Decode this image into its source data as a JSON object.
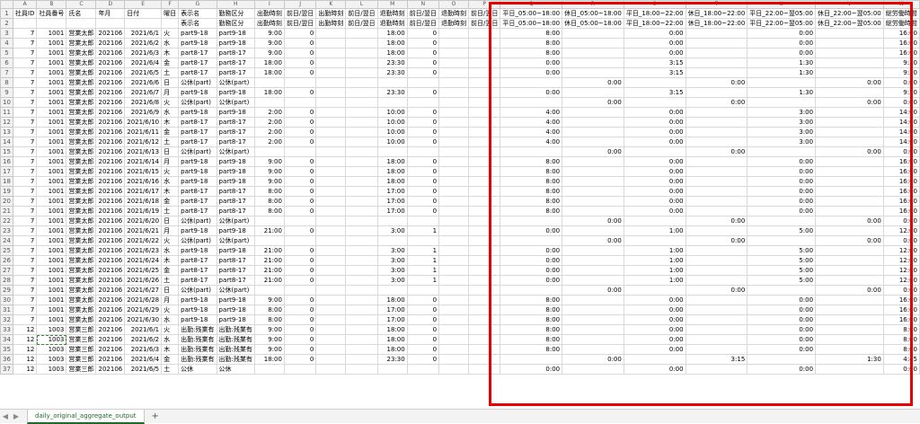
{
  "columns": [
    "A",
    "B",
    "C",
    "D",
    "E",
    "F",
    "G",
    "H",
    "I",
    "J",
    "K",
    "L",
    "M",
    "N",
    "O",
    "P",
    "Q",
    "R",
    "S",
    "T",
    "U",
    "V",
    "W"
  ],
  "header1": [
    "社員ID",
    "社員番号",
    "氏名",
    "年月",
    "日付",
    "曜日",
    "表示名",
    "勤務区分",
    "出勤時刻",
    "前日/翌日",
    "出勤時刻",
    "前日/翌日",
    "退勤時刻",
    "前日/翌日",
    "退勤時刻",
    "前日/翌日",
    "平日_05:00~18:00",
    "休日_05:00~18:00",
    "平日_18:00~22:00",
    "休日_18:00~22:00",
    "平日_22:00~翌05:00",
    "休日_22:00~翌05:00",
    "総労働時間"
  ],
  "header2": [
    "",
    "",
    "",
    "",
    "",
    "",
    "表示名",
    "勤務区分",
    "出勤時刻",
    "前日/翌日",
    "出勤時刻",
    "前日/翌日",
    "退勤時刻",
    "前日/翌日",
    "退勤時刻",
    "前日/翌日",
    "平日_05:00~18:00",
    "休日_05:00~18:00",
    "平日_18:00~22:00",
    "休日_18:00~22:00",
    "平日_22:00~翌05:00",
    "休日_22:00~翌05:00",
    "総労働時間"
  ],
  "rows": [
    [
      "7",
      "1001",
      "営業太郎",
      "202106",
      "2021/6/1",
      "火",
      "part9-18",
      "part9-18",
      "9:00",
      "0",
      "",
      "",
      "18:00",
      "0",
      "",
      "",
      "8:00",
      "",
      "0:00",
      "",
      "0:00",
      "",
      "16:00"
    ],
    [
      "7",
      "1001",
      "営業太郎",
      "202106",
      "2021/6/2",
      "水",
      "part9-18",
      "part9-18",
      "9:00",
      "0",
      "",
      "",
      "18:00",
      "0",
      "",
      "",
      "8:00",
      "",
      "0:00",
      "",
      "0:00",
      "",
      "16:00"
    ],
    [
      "7",
      "1001",
      "営業太郎",
      "202106",
      "2021/6/3",
      "木",
      "part8-17",
      "part8-17",
      "9:00",
      "0",
      "",
      "",
      "18:00",
      "0",
      "",
      "",
      "8:00",
      "",
      "0:00",
      "",
      "0:00",
      "",
      "16:00"
    ],
    [
      "7",
      "1001",
      "営業太郎",
      "202106",
      "2021/6/4",
      "金",
      "part8-17",
      "part8-17",
      "18:00",
      "0",
      "",
      "",
      "23:30",
      "0",
      "",
      "",
      "0:00",
      "",
      "3:15",
      "",
      "1:30",
      "",
      "9:30"
    ],
    [
      "7",
      "1001",
      "営業太郎",
      "202106",
      "2021/6/5",
      "土",
      "part8-17",
      "part8-17",
      "18:00",
      "0",
      "",
      "",
      "23:30",
      "0",
      "",
      "",
      "0:00",
      "",
      "3:15",
      "",
      "1:30",
      "",
      "9:30"
    ],
    [
      "7",
      "1001",
      "営業太郎",
      "202106",
      "2021/6/6",
      "日",
      "公休(part)",
      "公休(part)",
      "",
      "",
      "",
      "",
      "",
      "",
      "",
      "",
      "",
      "0:00",
      "",
      "0:00",
      "",
      "0:00",
      "0:00"
    ],
    [
      "7",
      "1001",
      "営業太郎",
      "202106",
      "2021/6/7",
      "月",
      "part9-18",
      "part9-18",
      "18:00",
      "0",
      "",
      "",
      "23:30",
      "0",
      "",
      "",
      "0:00",
      "",
      "3:15",
      "",
      "1:30",
      "",
      "9:30"
    ],
    [
      "7",
      "1001",
      "営業太郎",
      "202106",
      "2021/6/8",
      "火",
      "公休(part)",
      "公休(part)",
      "",
      "",
      "",
      "",
      "",
      "",
      "",
      "",
      "",
      "0:00",
      "",
      "0:00",
      "",
      "0:00",
      "0:00"
    ],
    [
      "7",
      "1001",
      "営業太郎",
      "202106",
      "2021/6/9",
      "水",
      "part9-18",
      "part9-18",
      "2:00",
      "0",
      "",
      "",
      "10:00",
      "0",
      "",
      "",
      "4:00",
      "",
      "0:00",
      "",
      "3:00",
      "",
      "14:00"
    ],
    [
      "7",
      "1001",
      "営業太郎",
      "202106",
      "2021/6/10",
      "木",
      "part8-17",
      "part8-17",
      "2:00",
      "0",
      "",
      "",
      "10:00",
      "0",
      "",
      "",
      "4:00",
      "",
      "0:00",
      "",
      "3:00",
      "",
      "14:00"
    ],
    [
      "7",
      "1001",
      "営業太郎",
      "202106",
      "2021/6/11",
      "金",
      "part8-17",
      "part8-17",
      "2:00",
      "0",
      "",
      "",
      "10:00",
      "0",
      "",
      "",
      "4:00",
      "",
      "0:00",
      "",
      "3:00",
      "",
      "14:00"
    ],
    [
      "7",
      "1001",
      "営業太郎",
      "202106",
      "2021/6/12",
      "土",
      "part8-17",
      "part8-17",
      "2:00",
      "0",
      "",
      "",
      "10:00",
      "0",
      "",
      "",
      "4:00",
      "",
      "0:00",
      "",
      "3:00",
      "",
      "14:00"
    ],
    [
      "7",
      "1001",
      "営業太郎",
      "202106",
      "2021/6/13",
      "日",
      "公休(part)",
      "公休(part)",
      "",
      "",
      "",
      "",
      "",
      "",
      "",
      "",
      "",
      "0:00",
      "",
      "0:00",
      "",
      "0:00",
      "0:00"
    ],
    [
      "7",
      "1001",
      "営業太郎",
      "202106",
      "2021/6/14",
      "月",
      "part9-18",
      "part9-18",
      "9:00",
      "0",
      "",
      "",
      "18:00",
      "0",
      "",
      "",
      "8:00",
      "",
      "0:00",
      "",
      "0:00",
      "",
      "16:00"
    ],
    [
      "7",
      "1001",
      "営業太郎",
      "202106",
      "2021/6/15",
      "火",
      "part9-18",
      "part9-18",
      "9:00",
      "0",
      "",
      "",
      "18:00",
      "0",
      "",
      "",
      "8:00",
      "",
      "0:00",
      "",
      "0:00",
      "",
      "16:00"
    ],
    [
      "7",
      "1001",
      "営業太郎",
      "202106",
      "2021/6/16",
      "水",
      "part9-18",
      "part9-18",
      "9:00",
      "0",
      "",
      "",
      "18:00",
      "0",
      "",
      "",
      "8:00",
      "",
      "0:00",
      "",
      "0:00",
      "",
      "16:00"
    ],
    [
      "7",
      "1001",
      "営業太郎",
      "202106",
      "2021/6/17",
      "木",
      "part8-17",
      "part8-17",
      "8:00",
      "0",
      "",
      "",
      "17:00",
      "0",
      "",
      "",
      "8:00",
      "",
      "0:00",
      "",
      "0:00",
      "",
      "16:00"
    ],
    [
      "7",
      "1001",
      "営業太郎",
      "202106",
      "2021/6/18",
      "金",
      "part8-17",
      "part8-17",
      "8:00",
      "0",
      "",
      "",
      "17:00",
      "0",
      "",
      "",
      "8:00",
      "",
      "0:00",
      "",
      "0:00",
      "",
      "16:00"
    ],
    [
      "7",
      "1001",
      "営業太郎",
      "202106",
      "2021/6/19",
      "土",
      "part8-17",
      "part8-17",
      "8:00",
      "0",
      "",
      "",
      "17:00",
      "0",
      "",
      "",
      "8:00",
      "",
      "0:00",
      "",
      "0:00",
      "",
      "16:00"
    ],
    [
      "7",
      "1001",
      "営業太郎",
      "202106",
      "2021/6/20",
      "日",
      "公休(part)",
      "公休(part)",
      "",
      "",
      "",
      "",
      "",
      "",
      "",
      "",
      "",
      "0:00",
      "",
      "0:00",
      "",
      "0:00",
      "0:00"
    ],
    [
      "7",
      "1001",
      "営業太郎",
      "202106",
      "2021/6/21",
      "月",
      "part9-18",
      "part9-18",
      "21:00",
      "0",
      "",
      "",
      "3:00",
      "1",
      "",
      "",
      "0:00",
      "",
      "1:00",
      "",
      "5:00",
      "",
      "12:00"
    ],
    [
      "7",
      "1001",
      "営業太郎",
      "202106",
      "2021/6/22",
      "火",
      "公休(part)",
      "公休(part)",
      "",
      "",
      "",
      "",
      "",
      "",
      "",
      "",
      "",
      "0:00",
      "",
      "0:00",
      "",
      "0:00",
      "0:00"
    ],
    [
      "7",
      "1001",
      "営業太郎",
      "202106",
      "2021/6/23",
      "水",
      "part9-18",
      "part9-18",
      "21:00",
      "0",
      "",
      "",
      "3:00",
      "1",
      "",
      "",
      "0:00",
      "",
      "1:00",
      "",
      "5:00",
      "",
      "12:00"
    ],
    [
      "7",
      "1001",
      "営業太郎",
      "202106",
      "2021/6/24",
      "木",
      "part8-17",
      "part8-17",
      "21:00",
      "0",
      "",
      "",
      "3:00",
      "1",
      "",
      "",
      "0:00",
      "",
      "1:00",
      "",
      "5:00",
      "",
      "12:00"
    ],
    [
      "7",
      "1001",
      "営業太郎",
      "202106",
      "2021/6/25",
      "金",
      "part8-17",
      "part8-17",
      "21:00",
      "0",
      "",
      "",
      "3:00",
      "1",
      "",
      "",
      "0:00",
      "",
      "1:00",
      "",
      "5:00",
      "",
      "12:00"
    ],
    [
      "7",
      "1001",
      "営業太郎",
      "202106",
      "2021/6/26",
      "土",
      "part8-17",
      "part8-17",
      "21:00",
      "0",
      "",
      "",
      "3:00",
      "1",
      "",
      "",
      "0:00",
      "",
      "1:00",
      "",
      "5:00",
      "",
      "12:00"
    ],
    [
      "7",
      "1001",
      "営業太郎",
      "202106",
      "2021/6/27",
      "日",
      "公休(part)",
      "公休(part)",
      "",
      "",
      "",
      "",
      "",
      "",
      "",
      "",
      "",
      "0:00",
      "",
      "0:00",
      "",
      "0:00",
      "0:00"
    ],
    [
      "7",
      "1001",
      "営業太郎",
      "202106",
      "2021/6/28",
      "月",
      "part9-18",
      "part9-18",
      "9:00",
      "0",
      "",
      "",
      "18:00",
      "0",
      "",
      "",
      "8:00",
      "",
      "0:00",
      "",
      "0:00",
      "",
      "16:00"
    ],
    [
      "7",
      "1001",
      "営業太郎",
      "202106",
      "2021/6/29",
      "火",
      "part9-18",
      "part9-18",
      "8:00",
      "0",
      "",
      "",
      "17:00",
      "0",
      "",
      "",
      "8:00",
      "",
      "0:00",
      "",
      "0:00",
      "",
      "16:00"
    ],
    [
      "7",
      "1001",
      "営業太郎",
      "202106",
      "2021/6/30",
      "水",
      "part9-18",
      "part9-18",
      "8:00",
      "0",
      "",
      "",
      "17:00",
      "0",
      "",
      "",
      "8:00",
      "",
      "0:00",
      "",
      "0:00",
      "",
      "16:00"
    ],
    [
      "12",
      "1003",
      "営業三郎",
      "202106",
      "2021/6/1",
      "火",
      "出勤:残業有",
      "出勤:残業有",
      "9:00",
      "0",
      "",
      "",
      "18:00",
      "0",
      "",
      "",
      "8:00",
      "",
      "0:00",
      "",
      "0:00",
      "",
      "8:00"
    ],
    [
      "12",
      "1003",
      "営業三郎",
      "202106",
      "2021/6/2",
      "水",
      "出勤:残業有",
      "出勤:残業有",
      "9:00",
      "0",
      "",
      "",
      "18:00",
      "0",
      "",
      "",
      "8:00",
      "",
      "0:00",
      "",
      "0:00",
      "",
      "8:00"
    ],
    [
      "12",
      "1003",
      "営業三郎",
      "202106",
      "2021/6/3",
      "木",
      "出勤:残業有",
      "出勤:残業有",
      "9:00",
      "0",
      "",
      "",
      "18:00",
      "0",
      "",
      "",
      "8:00",
      "",
      "0:00",
      "",
      "0:00",
      "",
      "8:00"
    ],
    [
      "12",
      "1003",
      "営業三郎",
      "202106",
      "2021/6/4",
      "金",
      "出勤:残業有",
      "出勤:残業有",
      "18:00",
      "0",
      "",
      "",
      "23:30",
      "0",
      "",
      "",
      "",
      "0:00",
      "",
      "3:15",
      "",
      "1:30",
      "4:45"
    ],
    [
      "12",
      "1003",
      "営業三郎",
      "202106",
      "2021/6/5",
      "土",
      "公休",
      "公休",
      "",
      "",
      "",
      "",
      "",
      "",
      "",
      "",
      "0:00",
      "",
      "0:00",
      "",
      "0:00",
      "",
      "0:00"
    ]
  ],
  "sheet_tab": "daily_original_aggregate_output",
  "add_sheet": "+",
  "nav_prev": "◀",
  "nav_next": "▶"
}
